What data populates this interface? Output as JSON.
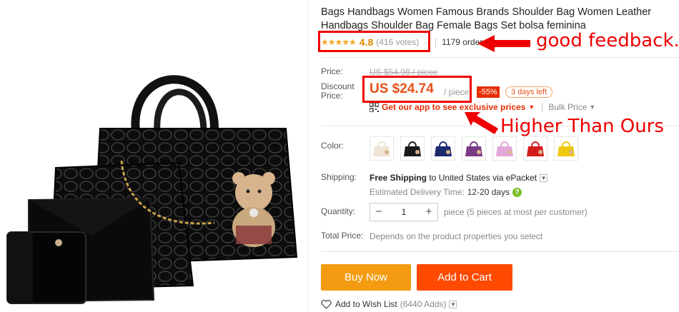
{
  "product": {
    "title_prefix_faded": "Bags ",
    "title": "Bags Handbags Women Famous Brands Shoulder Bag Women Leather Handbags Shoulder Bag Female Bags Set bolsa feminina",
    "stars": "★★★★★",
    "rating": "4.8",
    "votes": "(416 votes)",
    "orders": "1179 orders"
  },
  "price": {
    "price_label": "Price:",
    "old_price": "US $54.98 / piece",
    "discount_label_1": "Discount",
    "discount_label_2": "Price:",
    "new_price": "US $24.74",
    "per_piece": "/ piece",
    "discount": "-55%",
    "days_left": "3 days left",
    "app_link": "Get our app to see exclusive prices",
    "bulk_price": "Bulk Price"
  },
  "color": {
    "label": "Color:",
    "swatches": [
      {
        "name": "beige",
        "color": "#efe3d6"
      },
      {
        "name": "black",
        "color": "#1a1a1a"
      },
      {
        "name": "navy",
        "color": "#1c2a6e"
      },
      {
        "name": "purple",
        "color": "#7a3b86"
      },
      {
        "name": "pink",
        "color": "#e3a7d9"
      },
      {
        "name": "red",
        "color": "#d41c1c"
      },
      {
        "name": "yellow",
        "color": "#efc80f"
      }
    ]
  },
  "shipping": {
    "label": "Shipping:",
    "free_shipping": "Free Shipping",
    "rest": " to United States via ePacket",
    "estimated_label": "Estimated Delivery Time:",
    "days": "12-20 days"
  },
  "quantity": {
    "label": "Quantity:",
    "minus": "−",
    "value": "1",
    "plus": "+",
    "note": "piece (5 pieces at most per customer)"
  },
  "total": {
    "label": "Total Price:",
    "note": "Depends on the product properties you select"
  },
  "actions": {
    "buy_now": "Buy Now",
    "add_to_cart": "Add to Cart",
    "wishlist": "Add to Wish List",
    "wish_count": "(6440 Adds)"
  },
  "annotations": {
    "good_feedback": "good feedback.",
    "higher": "Higher Than Ours",
    "color": "#ee0000"
  }
}
